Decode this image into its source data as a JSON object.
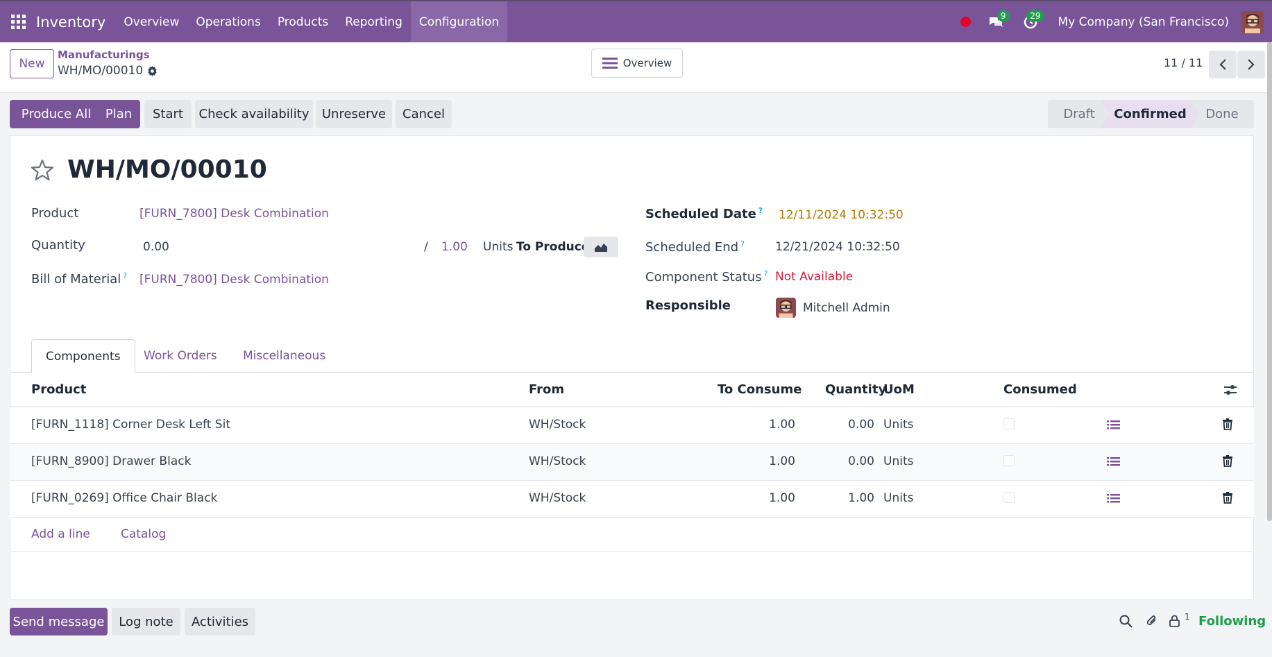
{
  "topnav": {
    "app_title": "Inventory",
    "menu": [
      "Overview",
      "Operations",
      "Products",
      "Reporting",
      "Configuration"
    ],
    "active_menu": "Configuration",
    "messages_count": "9",
    "activities_count": "29",
    "company": "My Company (San Francisco)"
  },
  "control": {
    "new_label": "New",
    "breadcrumb_parent": "Manufacturings",
    "breadcrumb_current": "WH/MO/00010",
    "overview_label": "Overview",
    "pager": "11 / 11"
  },
  "actions": {
    "produce_all": "Produce All",
    "plan": "Plan",
    "start": "Start",
    "check_availability": "Check availability",
    "unreserve": "Unreserve",
    "cancel": "Cancel"
  },
  "statusbar": {
    "draft": "Draft",
    "confirmed": "Confirmed",
    "done": "Done",
    "current": "Confirmed"
  },
  "form": {
    "title": "WH/MO/00010",
    "product_label": "Product",
    "product_value": "[FURN_7800] Desk Combination",
    "quantity_label": "Quantity",
    "quantity_value": "0.00",
    "quantity_sep": "/",
    "quantity_target": "1.00",
    "quantity_uom": "Units",
    "to_produce": "To Produce",
    "bom_label": "Bill of Material",
    "bom_value": "[FURN_7800] Desk Combination",
    "help": "?",
    "scheduled_date_label": "Scheduled Date",
    "scheduled_date_value": "12/11/2024 10:32:50",
    "scheduled_end_label": "Scheduled End",
    "scheduled_end_value": "12/21/2024 10:32:50",
    "component_status_label": "Component Status",
    "component_status_value": "Not Available",
    "responsible_label": "Responsible",
    "responsible_value": "Mitchell Admin"
  },
  "tabs": [
    "Components",
    "Work Orders",
    "Miscellaneous"
  ],
  "table": {
    "headers": {
      "product": "Product",
      "from": "From",
      "to_consume": "To Consume",
      "quantity": "Quantity",
      "uom": "UoM",
      "consumed": "Consumed"
    },
    "rows": [
      {
        "product": "[FURN_1118] Corner Desk Left Sit",
        "from": "WH/Stock",
        "to_consume": "1.00",
        "quantity": "0.00",
        "uom": "Units"
      },
      {
        "product": "[FURN_8900] Drawer Black",
        "from": "WH/Stock",
        "to_consume": "1.00",
        "quantity": "0.00",
        "uom": "Units"
      },
      {
        "product": "[FURN_0269] Office Chair Black",
        "from": "WH/Stock",
        "to_consume": "1.00",
        "quantity": "1.00",
        "uom": "Units"
      }
    ],
    "add_line": "Add a line",
    "catalog": "Catalog"
  },
  "chatter": {
    "send_message": "Send message",
    "log_note": "Log note",
    "activities": "Activities",
    "followers_count": "1",
    "following": "Following"
  },
  "colors": {
    "brand": "#7a5499",
    "warning": "#b07d00",
    "danger": "#d41c3a",
    "success": "#1e9e4a"
  }
}
